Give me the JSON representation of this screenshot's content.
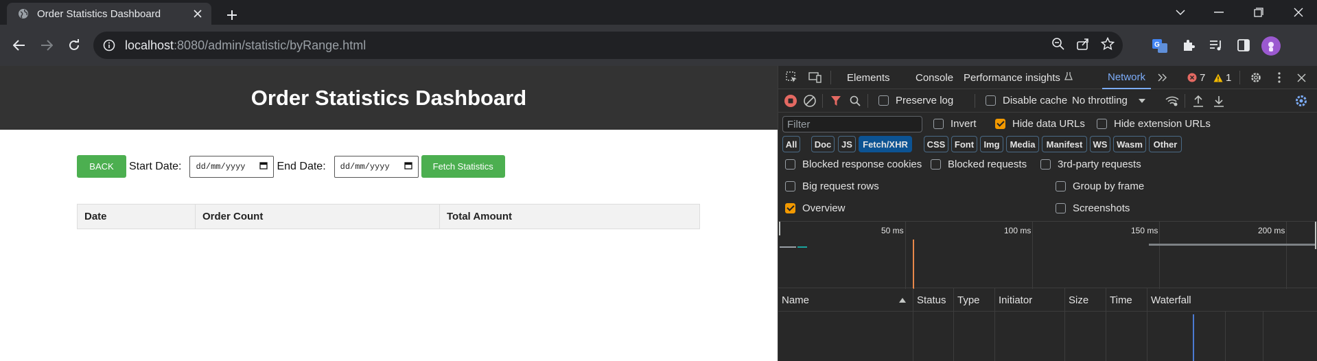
{
  "browser": {
    "tab_title": "Order Statistics Dashboard",
    "url_host": "localhost",
    "url_rest": ":8080/admin/statistic/byRange.html"
  },
  "page": {
    "title": "Order Statistics Dashboard",
    "back_label": "BACK",
    "start_label": "Start Date:",
    "end_label": "End Date:",
    "date_placeholder": "dd/mm/yyyy",
    "fetch_label": "Fetch Statistics",
    "table_headers": [
      "Date",
      "Order Count",
      "Total Amount"
    ],
    "accent_color": "#4caf50",
    "header_color": "#333333"
  },
  "devtools": {
    "tabs": [
      "Elements",
      "Console",
      "Performance insights",
      "Network"
    ],
    "active_tab": "Network",
    "error_count": "7",
    "warning_count": "1",
    "preserve_log": "Preserve log",
    "disable_cache": "Disable cache",
    "throttling": "No throttling",
    "filter_placeholder": "Filter",
    "invert": "Invert",
    "hide_data_urls": "Hide data URLs",
    "hide_extension_urls": "Hide extension URLs",
    "type_filters": [
      "All",
      "Doc",
      "JS",
      "Fetch/XHR",
      "CSS",
      "Font",
      "Img",
      "Media",
      "Manifest",
      "WS",
      "Wasm",
      "Other"
    ],
    "selected_type": "Fetch/XHR",
    "blocked_response_cookies": "Blocked response cookies",
    "blocked_requests": "Blocked requests",
    "third_party_requests": "3rd-party requests",
    "big_request_rows": "Big request rows",
    "group_by_frame": "Group by frame",
    "overview": "Overview",
    "screenshots": "Screenshots",
    "timeline_labels": [
      "50 ms",
      "100 ms",
      "150 ms",
      "200 ms"
    ],
    "columns": [
      "Name",
      "Status",
      "Type",
      "Initiator",
      "Size",
      "Time",
      "Waterfall"
    ]
  }
}
